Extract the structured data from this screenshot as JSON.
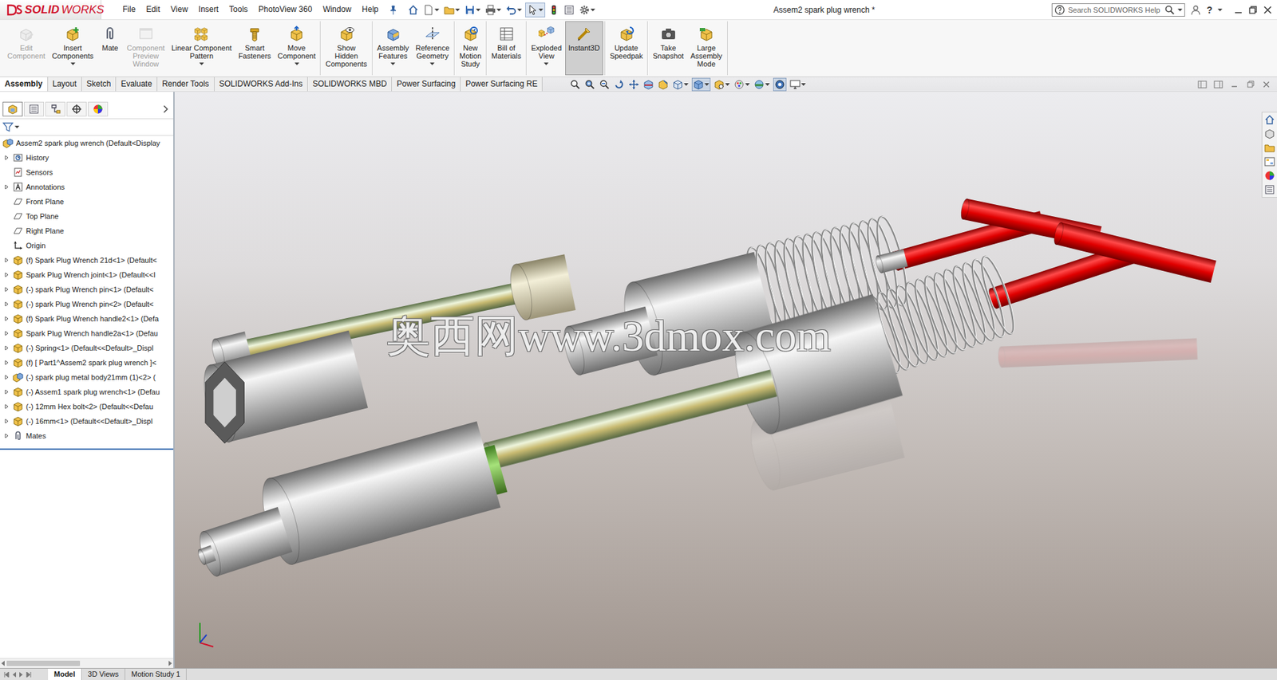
{
  "window": {
    "title": "Assem2 spark plug wrench *"
  },
  "logo": {
    "bold": "SOLID",
    "light": "WORKS"
  },
  "menu": [
    "File",
    "Edit",
    "View",
    "Insert",
    "Tools",
    "PhotoView 360",
    "Window",
    "Help"
  ],
  "search": {
    "placeholder": "Search SOLIDWORKS Help"
  },
  "help": "?",
  "ribbon": [
    {
      "buttons": [
        {
          "label": "Edit\nComponent",
          "disabled": true,
          "selected": false,
          "dropdown": false
        },
        {
          "label": "Insert\nComponents",
          "disabled": false,
          "selected": false,
          "dropdown": true
        },
        {
          "label": "Mate",
          "disabled": false,
          "selected": false,
          "dropdown": false
        },
        {
          "label": "Component\nPreview\nWindow",
          "disabled": true,
          "selected": false,
          "dropdown": false
        },
        {
          "label": "Linear Component\nPattern",
          "disabled": false,
          "selected": false,
          "dropdown": true
        },
        {
          "label": "Smart\nFasteners",
          "disabled": false,
          "selected": false,
          "dropdown": false
        },
        {
          "label": "Move\nComponent",
          "disabled": false,
          "selected": false,
          "dropdown": true
        }
      ]
    },
    {
      "buttons": [
        {
          "label": "Show\nHidden\nComponents",
          "disabled": false,
          "selected": false,
          "dropdown": false
        }
      ]
    },
    {
      "buttons": [
        {
          "label": "Assembly\nFeatures",
          "disabled": false,
          "selected": false,
          "dropdown": true
        },
        {
          "label": "Reference\nGeometry",
          "disabled": false,
          "selected": false,
          "dropdown": true
        }
      ]
    },
    {
      "buttons": [
        {
          "label": "New\nMotion\nStudy",
          "disabled": false,
          "selected": false,
          "dropdown": false
        }
      ]
    },
    {
      "buttons": [
        {
          "label": "Bill of\nMaterials",
          "disabled": false,
          "selected": false,
          "dropdown": false
        }
      ]
    },
    {
      "buttons": [
        {
          "label": "Exploded\nView",
          "disabled": false,
          "selected": false,
          "dropdown": true
        },
        {
          "label": "Instant3D",
          "disabled": false,
          "selected": true,
          "dropdown": false
        }
      ]
    },
    {
      "buttons": [
        {
          "label": "Update\nSpeedpak",
          "disabled": false,
          "selected": false,
          "dropdown": false
        }
      ]
    },
    {
      "buttons": [
        {
          "label": "Take\nSnapshot",
          "disabled": false,
          "selected": false,
          "dropdown": false
        },
        {
          "label": "Large\nAssembly\nMode",
          "disabled": false,
          "selected": false,
          "dropdown": false
        }
      ]
    }
  ],
  "command_tabs": [
    {
      "label": "Assembly",
      "selected": true
    },
    {
      "label": "Layout",
      "selected": false
    },
    {
      "label": "Sketch",
      "selected": false
    },
    {
      "label": "Evaluate",
      "selected": false
    },
    {
      "label": "Render Tools",
      "selected": false
    },
    {
      "label": "SOLIDWORKS Add-Ins",
      "selected": false
    },
    {
      "label": "SOLIDWORKS MBD",
      "selected": false
    },
    {
      "label": "Power Surfacing",
      "selected": false
    },
    {
      "label": "Power Surfacing RE",
      "selected": false
    }
  ],
  "tree": {
    "root": {
      "label": "Assem2 spark plug wrench  (Default<Display",
      "kind": "assembly"
    },
    "items": [
      {
        "label": "History",
        "kind": "history",
        "expandable": true
      },
      {
        "label": "Sensors",
        "kind": "sensors",
        "expandable": false
      },
      {
        "label": "Annotations",
        "kind": "annotations",
        "expandable": true
      },
      {
        "label": "Front Plane",
        "kind": "plane",
        "expandable": false
      },
      {
        "label": "Top Plane",
        "kind": "plane",
        "expandable": false
      },
      {
        "label": "Right Plane",
        "kind": "plane",
        "expandable": false
      },
      {
        "label": "Origin",
        "kind": "origin",
        "expandable": false
      },
      {
        "label": "(f) Spark Plug Wrench 21d<1> (Default<",
        "kind": "part",
        "expandable": true
      },
      {
        "label": "Spark Plug Wrench joint<1> (Default<<I",
        "kind": "part",
        "expandable": true
      },
      {
        "label": "(-) spark Plug Wrench pin<1> (Default<",
        "kind": "part",
        "expandable": true
      },
      {
        "label": "(-) spark Plug Wrench pin<2> (Default<",
        "kind": "part",
        "expandable": true
      },
      {
        "label": "(f) Spark Plug Wrench handle2<1> (Defa",
        "kind": "part",
        "expandable": true
      },
      {
        "label": "Spark Plug Wrench handle2a<1> (Defau",
        "kind": "part",
        "expandable": true
      },
      {
        "label": "(-) Spring<1> (Default<<Default>_Displ",
        "kind": "part",
        "expandable": true
      },
      {
        "label": "(f) [ Part1^Assem2 spark plug wrench ]<",
        "kind": "part",
        "expandable": true
      },
      {
        "label": "(-) spark plug metal body21mm (1)<2> (",
        "kind": "assembly",
        "expandable": true
      },
      {
        "label": "(-) Assem1 spark plug wrench<1> (Defau",
        "kind": "part",
        "expandable": true
      },
      {
        "label": "(-) 12mm Hex bolt<2> (Default<<Defau",
        "kind": "part",
        "expandable": true
      },
      {
        "label": "(-) 16mm<1> (Default<<Default>_Displ",
        "kind": "part",
        "expandable": true
      },
      {
        "label": "Mates",
        "kind": "mates",
        "expandable": true
      }
    ]
  },
  "watermark": "奥西网www.3dmox.com",
  "bottom_tabs": [
    {
      "label": "Model",
      "selected": true
    },
    {
      "label": "3D Views",
      "selected": false
    },
    {
      "label": "Motion Study 1",
      "selected": false
    }
  ]
}
